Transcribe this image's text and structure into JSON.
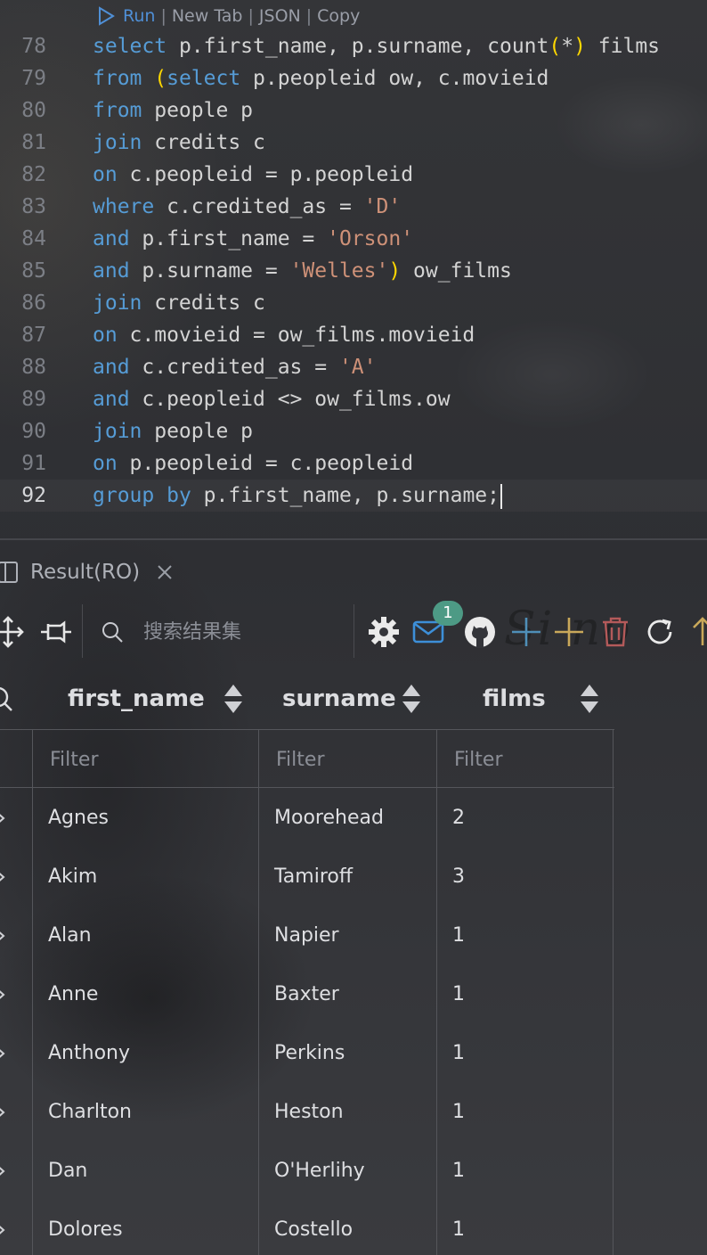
{
  "codelens": {
    "run": "Run",
    "new_tab": "New Tab",
    "json": "JSON",
    "copy": "Copy",
    "separator": "|"
  },
  "code_lines": [
    {
      "num": "78",
      "tokens": [
        {
          "t": "select",
          "c": "kw"
        },
        {
          "t": " p.first_name, p.surname, count"
        },
        {
          "t": "(",
          "c": "paren"
        },
        {
          "t": "*"
        },
        {
          "t": ")",
          "c": "paren"
        },
        {
          "t": " films"
        }
      ]
    },
    {
      "num": "79",
      "tokens": [
        {
          "t": "from",
          "c": "kw"
        },
        {
          "t": " "
        },
        {
          "t": "(",
          "c": "paren"
        },
        {
          "t": "select",
          "c": "kw"
        },
        {
          "t": " p.peopleid ow, c.movieid"
        }
      ]
    },
    {
      "num": "80",
      "tokens": [
        {
          "t": "from",
          "c": "kw"
        },
        {
          "t": " people p"
        }
      ]
    },
    {
      "num": "81",
      "tokens": [
        {
          "t": "join",
          "c": "kw"
        },
        {
          "t": " credits c"
        }
      ]
    },
    {
      "num": "82",
      "tokens": [
        {
          "t": "on",
          "c": "kw"
        },
        {
          "t": " c.peopleid = p.peopleid"
        }
      ]
    },
    {
      "num": "83",
      "tokens": [
        {
          "t": "where",
          "c": "kw"
        },
        {
          "t": " c.credited_as = "
        },
        {
          "t": "'D'",
          "c": "str"
        }
      ]
    },
    {
      "num": "84",
      "tokens": [
        {
          "t": "and",
          "c": "kw"
        },
        {
          "t": " p.first_name = "
        },
        {
          "t": "'Orson'",
          "c": "str"
        }
      ]
    },
    {
      "num": "85",
      "tokens": [
        {
          "t": "and",
          "c": "kw"
        },
        {
          "t": " p.surname = "
        },
        {
          "t": "'Welles'",
          "c": "str"
        },
        {
          "t": ")",
          "c": "paren"
        },
        {
          "t": " ow_films"
        }
      ]
    },
    {
      "num": "86",
      "tokens": [
        {
          "t": "join",
          "c": "kw"
        },
        {
          "t": " credits c"
        }
      ]
    },
    {
      "num": "87",
      "tokens": [
        {
          "t": "on",
          "c": "kw"
        },
        {
          "t": " c.movieid = ow_films.movieid"
        }
      ]
    },
    {
      "num": "88",
      "tokens": [
        {
          "t": "and",
          "c": "kw"
        },
        {
          "t": " c.credited_as = "
        },
        {
          "t": "'A'",
          "c": "str"
        }
      ]
    },
    {
      "num": "89",
      "tokens": [
        {
          "t": "and",
          "c": "kw"
        },
        {
          "t": " c.peopleid <> ow_films.ow"
        }
      ]
    },
    {
      "num": "90",
      "tokens": [
        {
          "t": "join",
          "c": "kw"
        },
        {
          "t": " people p"
        }
      ]
    },
    {
      "num": "91",
      "tokens": [
        {
          "t": "on",
          "c": "kw"
        },
        {
          "t": " p.peopleid = c.peopleid"
        }
      ]
    },
    {
      "num": "92",
      "current": true,
      "tokens": [
        {
          "t": "group",
          "c": "kw"
        },
        {
          "t": " "
        },
        {
          "t": "by",
          "c": "kw"
        },
        {
          "t": " p.first_name, p.surname;"
        }
      ]
    }
  ],
  "panel": {
    "tab_label": "Result(RO)",
    "search_placeholder": "搜索结果集",
    "notification_count": "1",
    "watermark": "Si no",
    "icons": [
      "move-icon",
      "pin-icon",
      "gear-icon",
      "mail-icon",
      "github-icon",
      "add-row-icon",
      "insert-row-icon",
      "delete-icon",
      "refresh-icon",
      "arrow-up-icon"
    ],
    "colors": {
      "badge": "#4d9a85",
      "add": "#4f8fb8",
      "insert": "#c9a85a",
      "delete": "#b45a5a"
    }
  },
  "grid": {
    "columns": [
      "first_name",
      "surname",
      "films"
    ],
    "filter_placeholder": "Filter",
    "rows": [
      [
        "Agnes",
        "Moorehead",
        "2"
      ],
      [
        "Akim",
        "Tamiroff",
        "3"
      ],
      [
        "Alan",
        "Napier",
        "1"
      ],
      [
        "Anne",
        "Baxter",
        "1"
      ],
      [
        "Anthony",
        "Perkins",
        "1"
      ],
      [
        "Charlton",
        "Heston",
        "1"
      ],
      [
        "Dan",
        "O'Herlihy",
        "1"
      ],
      [
        "Dolores",
        "Costello",
        "1"
      ]
    ]
  }
}
